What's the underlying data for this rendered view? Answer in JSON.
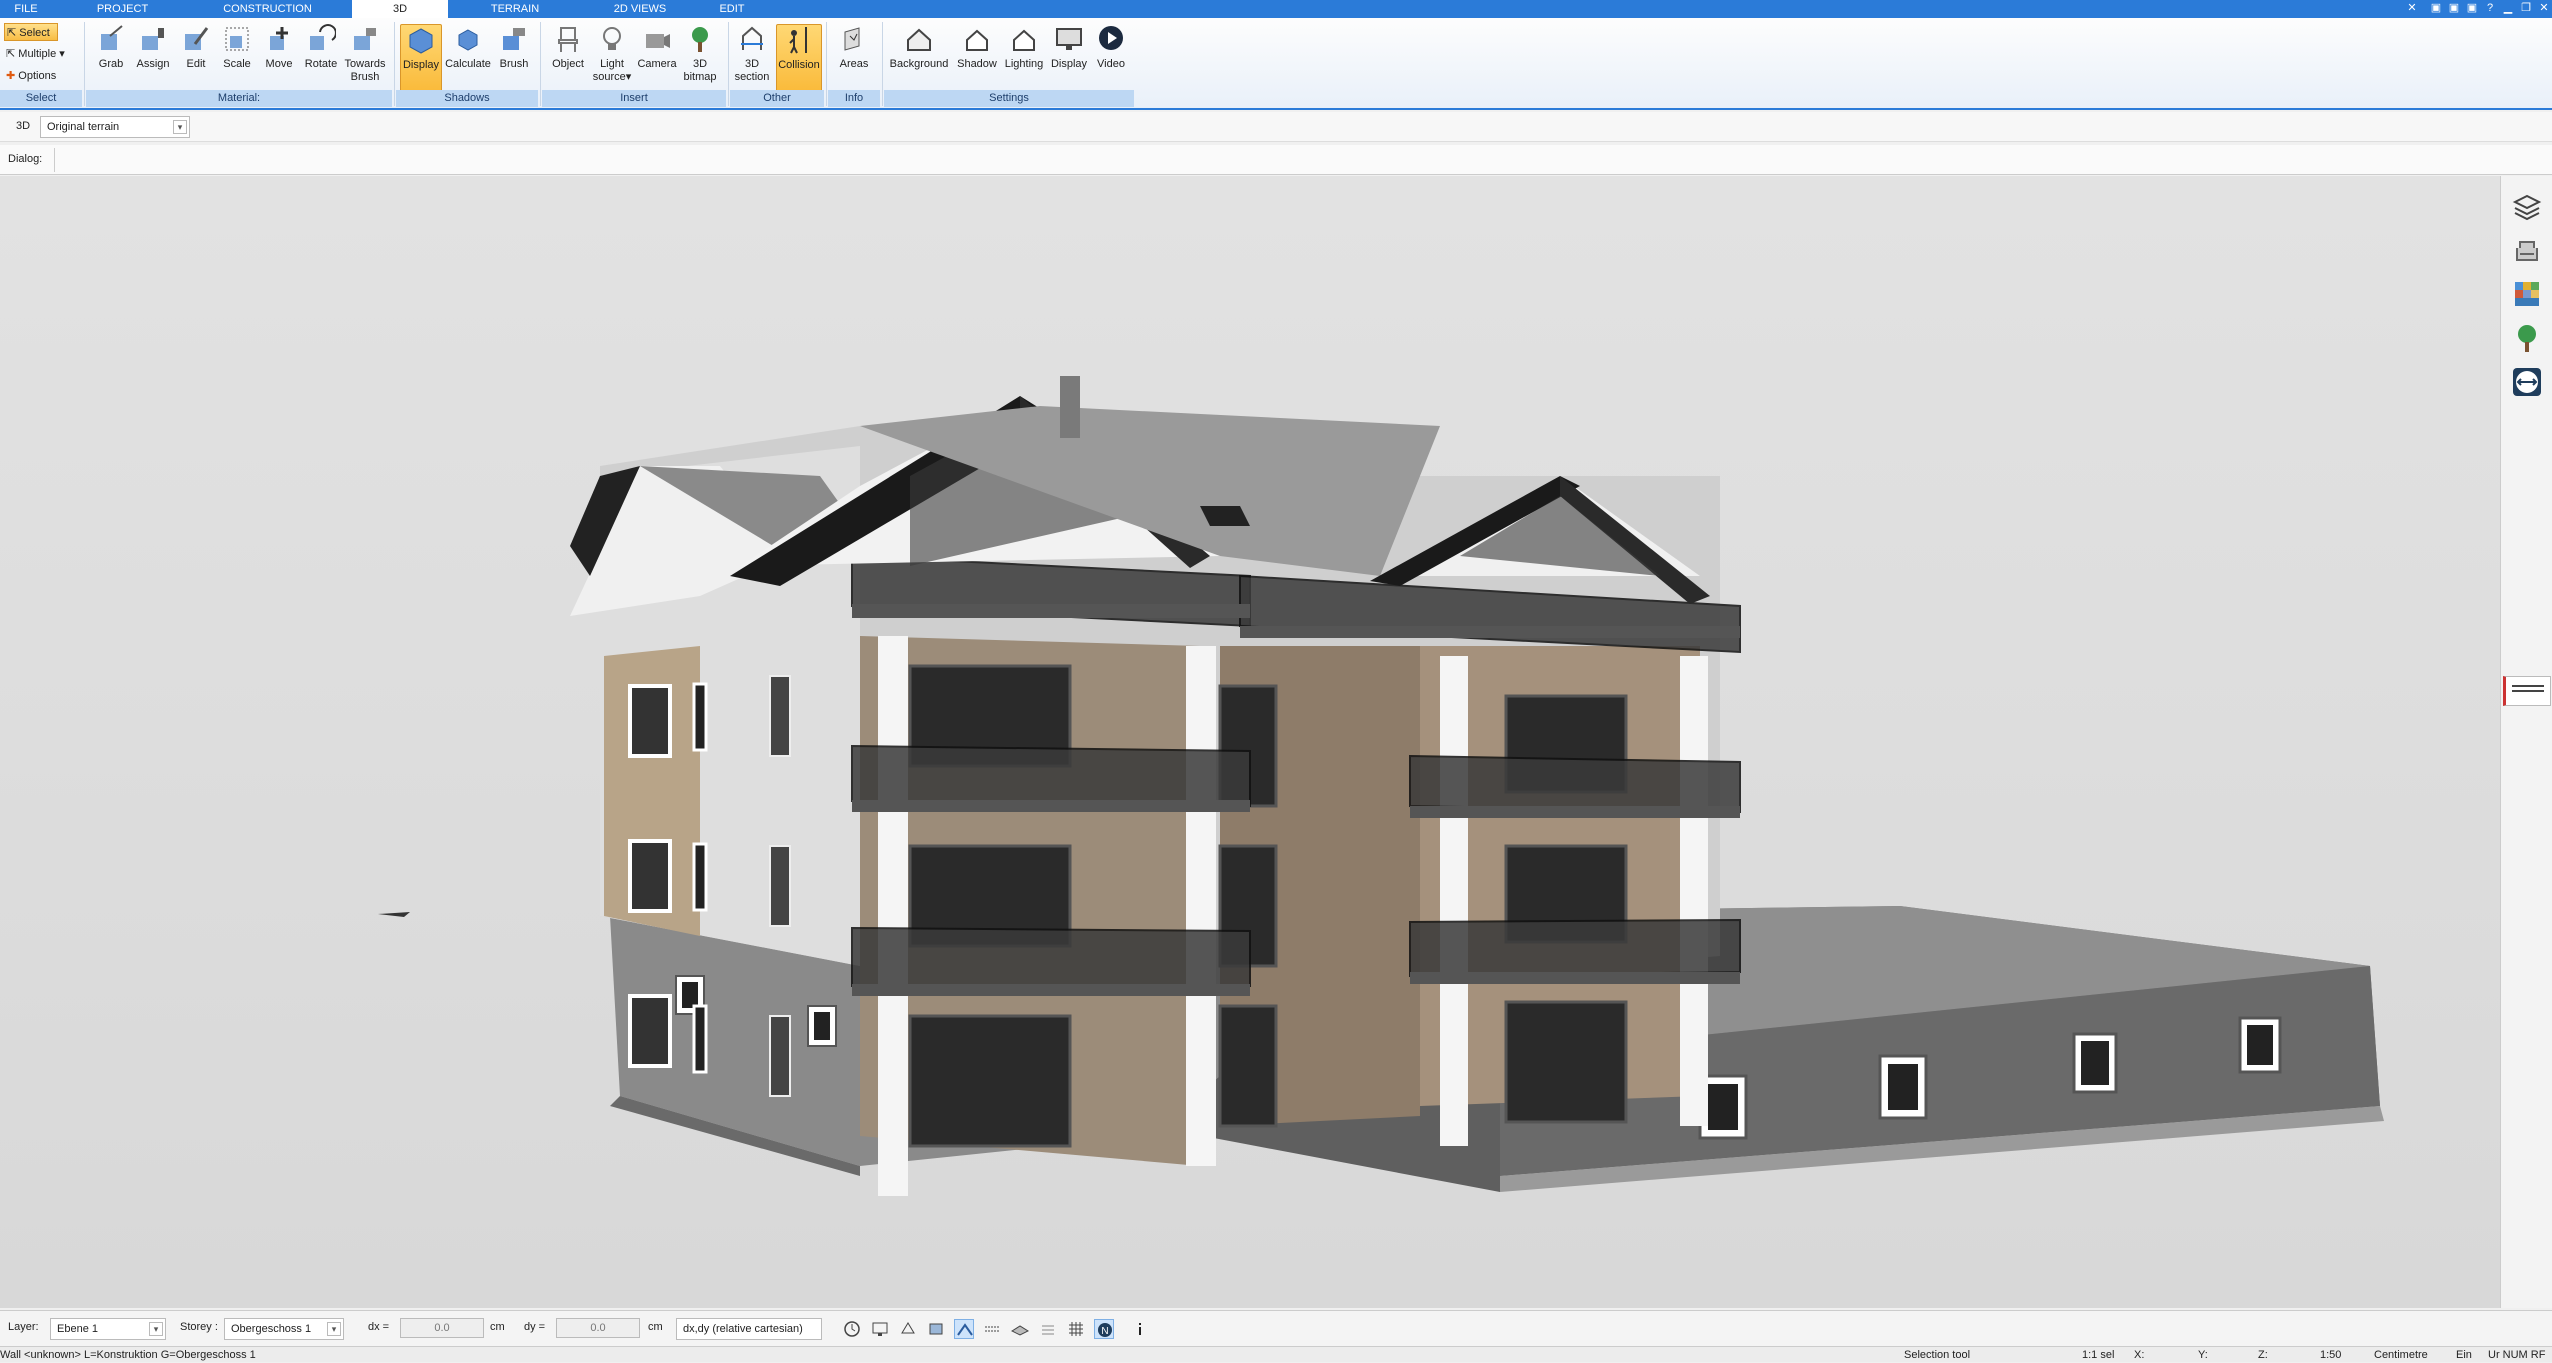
{
  "menu_tabs": [
    "FILE",
    "PROJECT",
    "CONSTRUCTION",
    "3D",
    "TERRAIN",
    "2D VIEWS",
    "EDIT"
  ],
  "active_tab": "3D",
  "ribbon": {
    "select": {
      "select": "Select",
      "multiple": "Multiple",
      "options": "Options",
      "group": "Select"
    },
    "material": {
      "grab": "Grab",
      "assign": "Assign",
      "edit": "Edit",
      "scale": "Scale",
      "move": "Move",
      "rotate": "Rotate",
      "towards_brush_1": "Towards",
      "towards_brush_2": "Brush",
      "group": "Material:"
    },
    "shadows": {
      "display": "Display",
      "calculate": "Calculate",
      "brush": "Brush",
      "group": "Shadows"
    },
    "insert": {
      "object": "Object",
      "light_1": "Light",
      "light_2": "source",
      "camera": "Camera",
      "bitmap_1": "3D",
      "bitmap_2": "bitmap",
      "group": "Insert"
    },
    "other": {
      "section_1": "3D",
      "section_2": "section",
      "collision": "Collision",
      "group": "Other"
    },
    "info": {
      "areas": "Areas",
      "group": "Info"
    },
    "settings": {
      "background": "Background",
      "shadow": "Shadow",
      "lighting": "Lighting",
      "display": "Display",
      "video": "Video",
      "group": "Settings"
    }
  },
  "options_row": {
    "mode_label": "3D",
    "terrain_value": "Original terrain"
  },
  "dialog_row": {
    "label": "Dialog:"
  },
  "status_bar": {
    "layer_label": "Layer:",
    "layer_value": "Ebene 1",
    "storey_label": "Storey :",
    "storey_value": "Obergeschoss 1",
    "dx_label": "dx =",
    "dx_value": "0.0",
    "dx_unit": "cm",
    "dy_label": "dy =",
    "dy_value": "0.0",
    "dy_unit": "cm",
    "coord_mode": "dx,dy (relative cartesian)"
  },
  "status_line": {
    "object_info": "Wall <unknown> L=Konstruktion G=Obergeschoss 1",
    "tool": "Selection tool",
    "sel": "1:1 sel",
    "x": "X:",
    "y": "Y:",
    "z": "Z:",
    "scale": "1:50",
    "unit": "Centimetre",
    "ein": "Ein",
    "flags": "Ur  NUM  RF"
  },
  "colors": {
    "accent": "#2b7bd8",
    "active_button": "#f9b632",
    "viewport_bg": "#dcdcdc"
  }
}
